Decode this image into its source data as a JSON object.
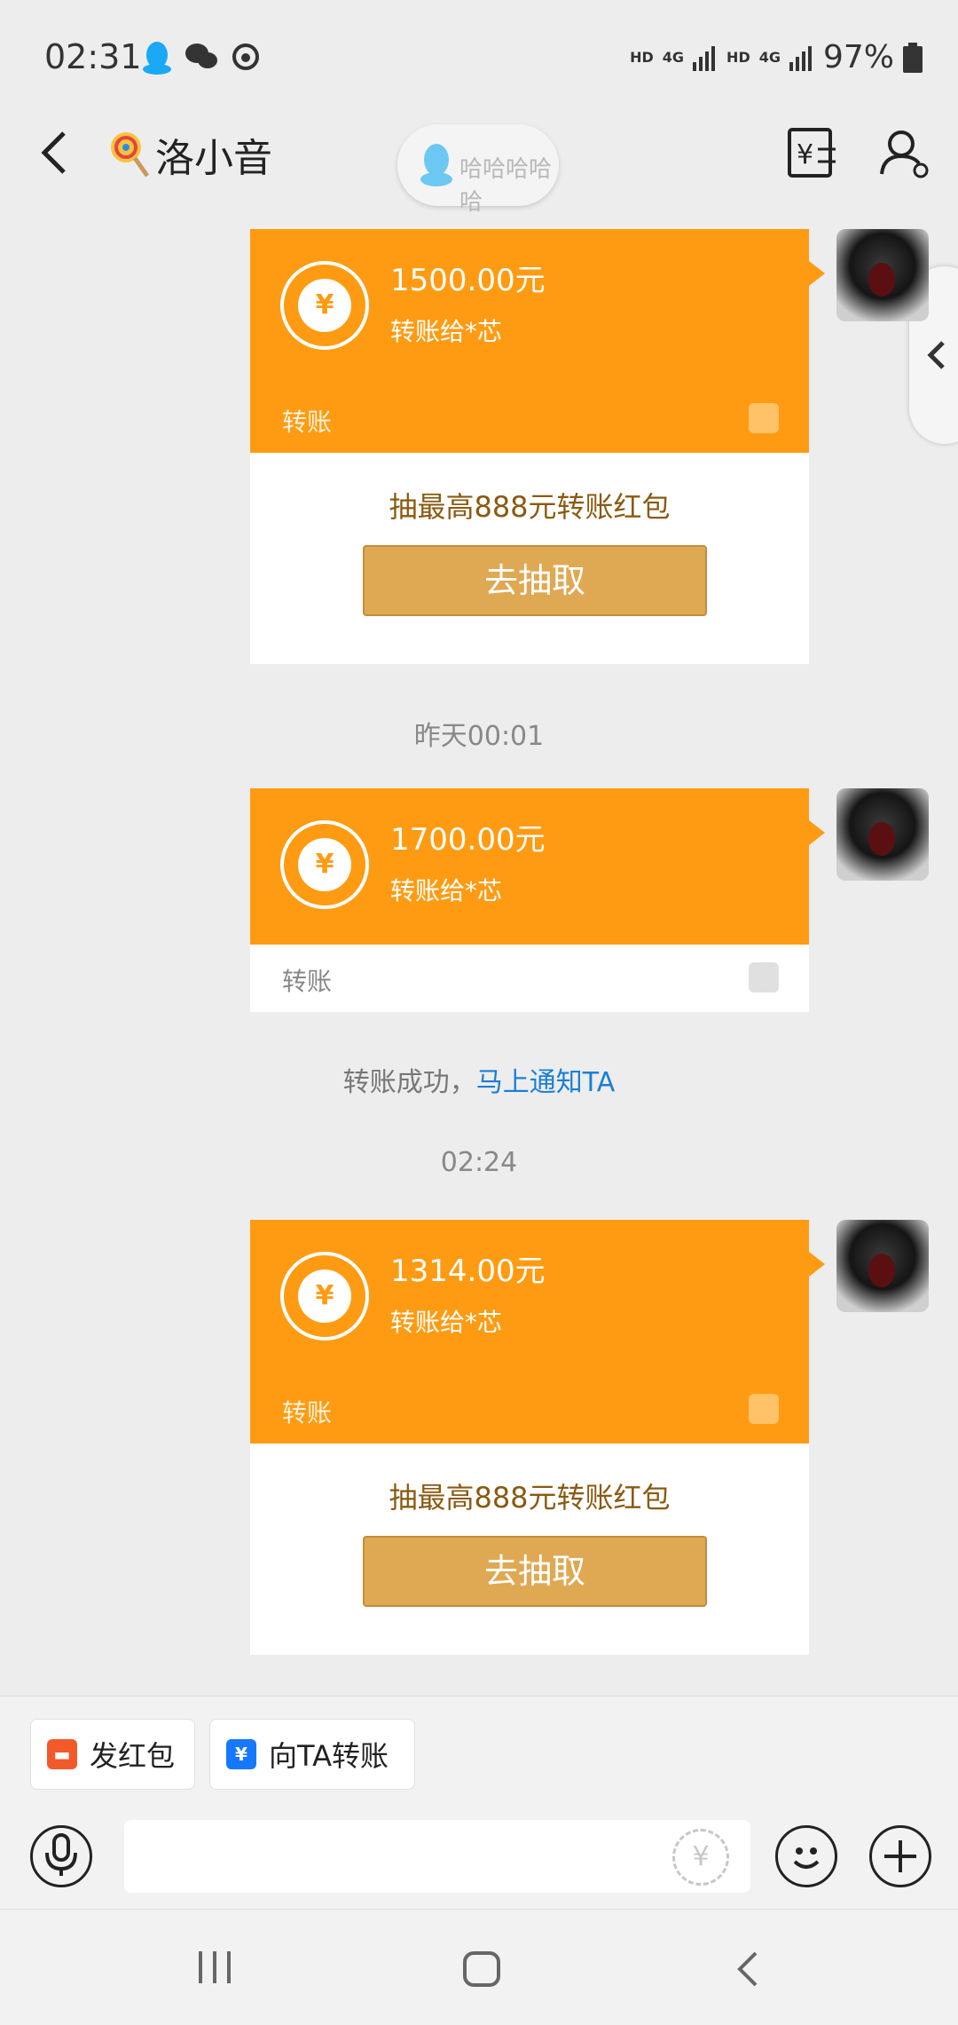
{
  "status_bar": {
    "time": "02:31",
    "hd1": "HD",
    "net1": "4G",
    "hd2": "HD",
    "net2": "4G",
    "battery": "97%"
  },
  "header": {
    "title": "洛小音",
    "floating_bubble": "哈哈哈哈哈"
  },
  "messages": [
    {
      "amount": "1500.00元",
      "to": "转账给*芯",
      "label": "转账",
      "promo": "抽最高888元转账红包",
      "button": "去抽取"
    },
    {
      "timestamp": "昨天00:01"
    },
    {
      "amount": "1700.00元",
      "to": "转账给*芯",
      "label": "转账"
    },
    {
      "system": "转账成功，",
      "system_link": "马上通知TA"
    },
    {
      "timestamp": "02:24"
    },
    {
      "amount": "1314.00元",
      "to": "转账给*芯",
      "label": "转账",
      "promo": "抽最高888元转账红包",
      "button": "去抽取"
    }
  ],
  "quick_actions": [
    {
      "label": "发红包",
      "icon": "red-envelope-icon",
      "color": "#f25a2c"
    },
    {
      "label": "向TA转账",
      "icon": "transfer-icon",
      "color": "#1677ff"
    }
  ],
  "colors": {
    "transfer_orange": "#ff9b12",
    "button_gold": "#dfa852",
    "link_blue": "#1a7fd6"
  },
  "icons": {
    "back": "back-arrow-icon",
    "transfer_record": "transfer-record-icon",
    "profile": "profile-icon",
    "voice": "microphone-icon",
    "yen_input": "yen-icon",
    "emoji": "emoji-icon",
    "plus": "plus-icon"
  }
}
